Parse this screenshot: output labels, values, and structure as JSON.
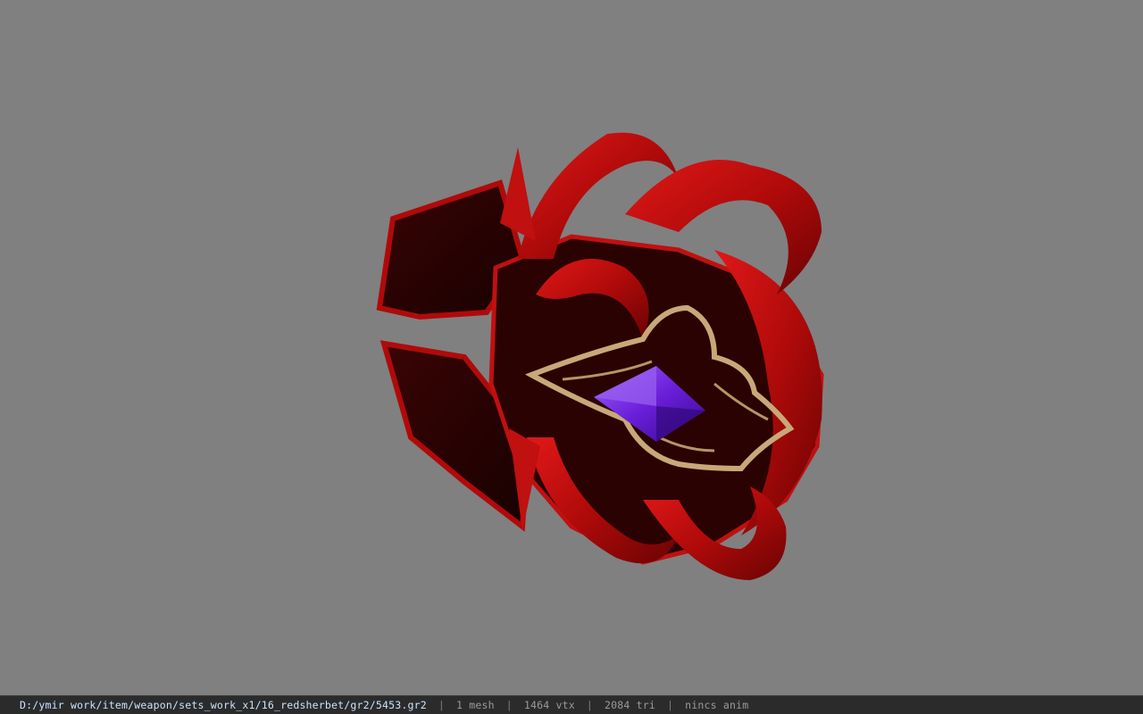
{
  "viewer": {
    "background_color": "#808080",
    "model_icon": "red-horned-shield-with-purple-gem"
  },
  "status_bar": {
    "file_path": "D:/ymir work/item/weapon/sets_work_x1/16_redsherbet/gr2/5453.gr2",
    "separator": "|",
    "mesh_count": "1 mesh",
    "vertex_count": "1464 vtx",
    "triangle_count": "2084 tri",
    "anim_status": "nincs anim"
  }
}
